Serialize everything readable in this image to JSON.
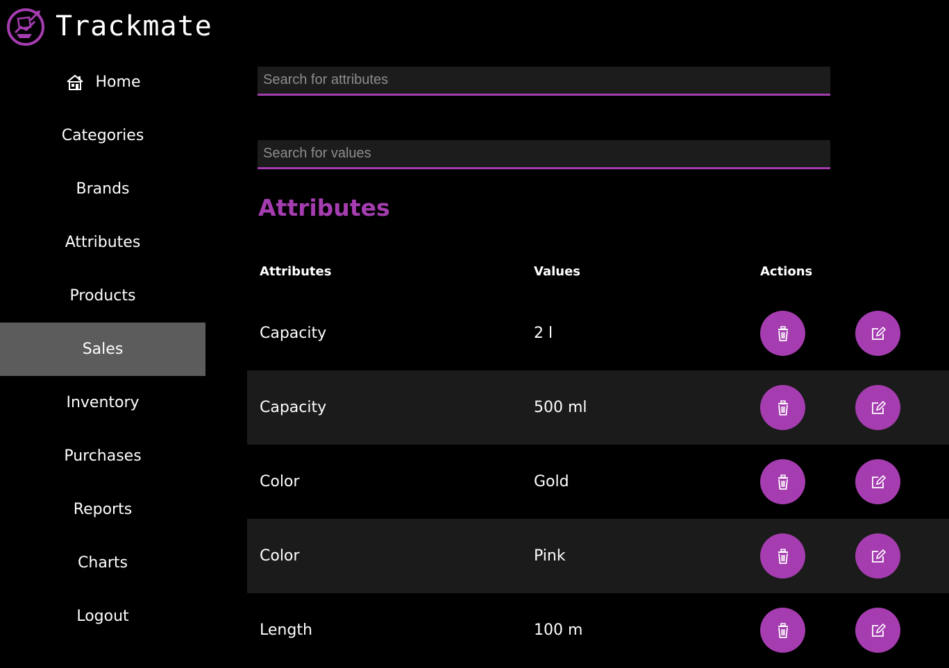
{
  "app": {
    "name": "Trackmate"
  },
  "sidebar": {
    "items": [
      {
        "label": "Home",
        "icon": "home-icon"
      },
      {
        "label": "Categories"
      },
      {
        "label": "Brands"
      },
      {
        "label": "Attributes"
      },
      {
        "label": "Products"
      },
      {
        "label": "Sales",
        "active": true
      },
      {
        "label": "Inventory"
      },
      {
        "label": "Purchases"
      },
      {
        "label": "Reports"
      },
      {
        "label": "Charts"
      },
      {
        "label": "Logout"
      }
    ]
  },
  "search": {
    "attributes_placeholder": "Search for attributes",
    "attributes_value": "",
    "values_placeholder": "Search for values",
    "values_value": ""
  },
  "main": {
    "title": "Attributes"
  },
  "table": {
    "headers": {
      "attribute": "Attributes",
      "value": "Values",
      "actions": "Actions"
    },
    "rows": [
      {
        "attribute": "Capacity",
        "value": "2 l"
      },
      {
        "attribute": "Capacity",
        "value": "500 ml"
      },
      {
        "attribute": "Color",
        "value": "Gold"
      },
      {
        "attribute": "Color",
        "value": "Pink"
      },
      {
        "attribute": "Length",
        "value": "100 m"
      }
    ],
    "action_icons": [
      "trash-icon",
      "edit-icon"
    ]
  },
  "colors": {
    "accent": "#a53db0",
    "background": "#000000",
    "active_nav": "#5c5c5c",
    "stripe": "#1b1b1b",
    "input_bg": "#1c1c1c"
  }
}
